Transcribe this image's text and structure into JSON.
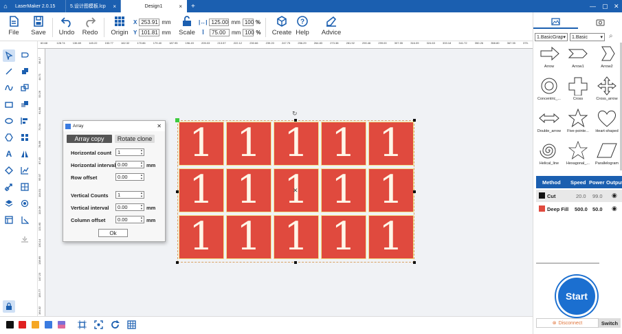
{
  "titlebar": {
    "tabs": [
      {
        "label": "LaserMaker 2.0.15"
      },
      {
        "label": "5.设计图模板.lcp"
      },
      {
        "label": "Design1"
      }
    ]
  },
  "toolbar": {
    "file": "File",
    "save": "Save",
    "undo": "Undo",
    "redo": "Redo",
    "origin": "Origin",
    "x_label": "X",
    "x_value": "253.91",
    "y_label": "Y",
    "y_value": "101.81",
    "unit_mm": "mm",
    "scale": "Scale",
    "width_value": "125.00",
    "height_value": "75.00",
    "width_pct": "100",
    "height_pct": "100",
    "pct": "%",
    "create": "Create",
    "help": "Help",
    "advice": "Advice"
  },
  "ruler": {
    "h": [
      "60.68",
      "128.74",
      "136.69",
      "145.22",
      "153.77",
      "162.32",
      "170.86",
      "179.40",
      "187.95",
      "196.49",
      "205.03",
      "213.57",
      "222.12",
      "230.66",
      "239.20",
      "247.75",
      "256.29",
      "264.83",
      "273.38",
      "281.92",
      "290.46",
      "299.00",
      "307.55",
      "316.09",
      "324.63",
      "333.18",
      "341.72",
      "350.26",
      "358.80",
      "367.35",
      "375."
    ],
    "v": [
      "36.17",
      "44.71",
      "53.26",
      "61.80",
      "70.34",
      "78.89",
      "87.43",
      "95.97",
      "104.51",
      "113.06",
      "121.60",
      "130.14",
      "138.69",
      "147.23",
      "155.77",
      "164.32"
    ]
  },
  "grid": {
    "rows": 3,
    "cols": 5,
    "cell_text": "1"
  },
  "dialog": {
    "title": "Array",
    "tab_array": "Array copy",
    "tab_rotate": "Rotate clone",
    "h_count_label": "Horizontal count",
    "h_count": "1",
    "h_interval_label": "Horizontal interval",
    "h_interval": "0.00",
    "row_offset_label": "Row offset",
    "row_offset": "0.00",
    "v_count_label": "Vertical Counts",
    "v_count": "1",
    "v_interval_label": "Vertical interval",
    "v_interval": "0.00",
    "col_offset_label": "Column offset",
    "col_offset": "0.00",
    "unit": "mm",
    "ok": "Ok"
  },
  "right": {
    "lib_select": "1.BasicGrap",
    "sub_select": "1.Basic",
    "shapes": [
      "Arrow",
      "Arrow1",
      "Arrow2",
      "Concentric_...",
      "Cross",
      "Cross_arrow",
      "Double_arrow",
      "Five-pointe...",
      "Heart-shaped",
      "Helical_line",
      "Hexagonal_...",
      "Parallelogram"
    ],
    "layers_head": {
      "method": "Method",
      "speed": "Speed",
      "power": "Power",
      "output": "Output"
    },
    "layers": [
      {
        "name": "Cut",
        "speed": "20.0",
        "power": "99.0",
        "color": "#111111"
      },
      {
        "name": "Deep Fill",
        "speed": "500.0",
        "power": "50.0",
        "color": "#e04a3e"
      }
    ],
    "start": "Start",
    "disconnect": "Disconnect",
    "switch": "Switch"
  },
  "colors": {
    "brand": "#1b5fb0",
    "cell_fill": "#e04a3e",
    "swatches": [
      "#111111",
      "#e02020",
      "#f5a623",
      "#3a7be0",
      "#7a6fd8"
    ]
  }
}
